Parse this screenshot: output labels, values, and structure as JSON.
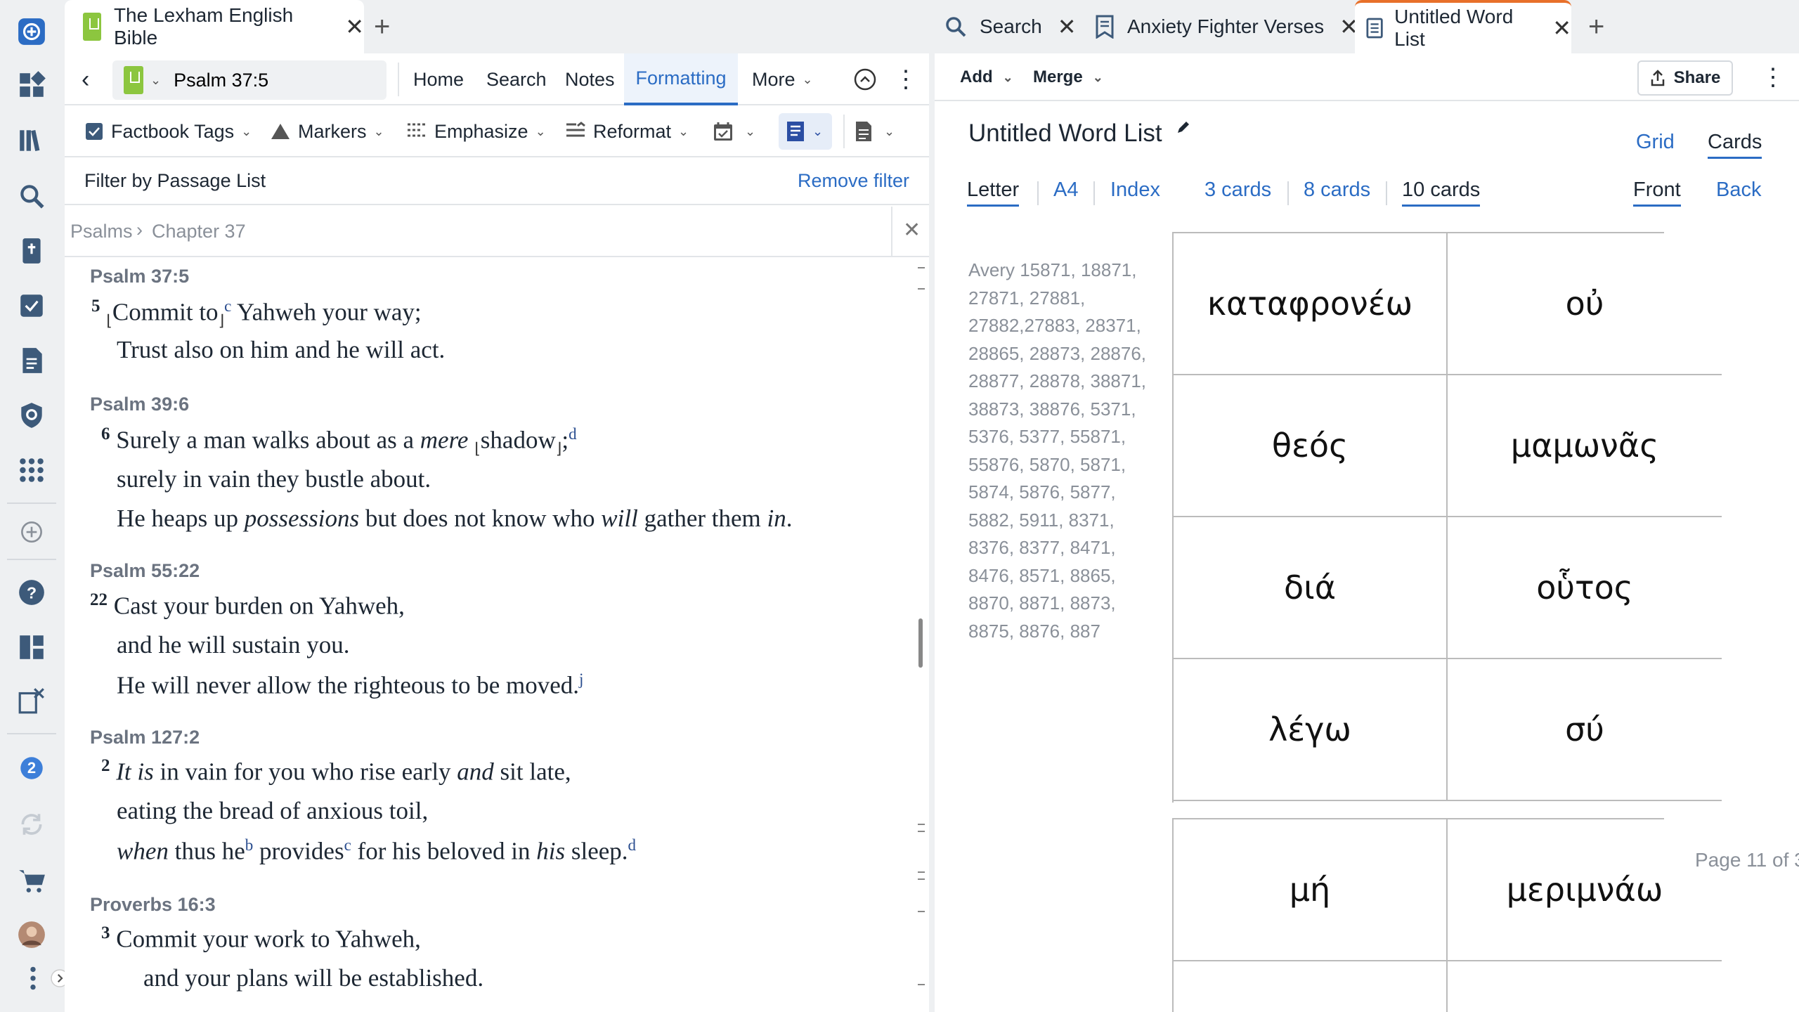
{
  "left": {
    "tab_title": "The Lexham English Bible",
    "reference": "Psalm 37:5",
    "nav": [
      "Home",
      "Search",
      "Notes",
      "Formatting",
      "More"
    ],
    "tools": {
      "factbook": "Factbook Tags",
      "markers": "Markers",
      "emphasize": "Emphasize",
      "reformat": "Reformat"
    },
    "filter_label": "Filter by Passage List",
    "remove_filter": "Remove filter",
    "breadcrumb": [
      "Psalms",
      "Chapter 37"
    ]
  },
  "passages": [
    {
      "heading": "Psalm 37:5",
      "verse": "5",
      "lines": [
        "Commit to",
        "Yahweh your way;",
        "Trust also on him and he will act."
      ],
      "fn": "c"
    },
    {
      "heading": "Psalm 39:6",
      "verse": "6",
      "lines": [
        "Surely a man walks about as a",
        "mere",
        "shadow",
        ";",
        "surely in vain they bustle about.",
        "He heaps up",
        "possessions",
        "but does not know who",
        "will",
        "gather them",
        "in",
        "."
      ],
      "fn": "d"
    },
    {
      "heading": "Psalm 55:22",
      "verse": "22",
      "lines": [
        "Cast your burden on Yahweh,",
        "and he will sustain you.",
        "He will never allow the righteous to be moved."
      ],
      "fn": "j"
    },
    {
      "heading": "Psalm 127:2",
      "verse": "2",
      "lines": [
        "It is",
        "in vain for you who rise early",
        "and",
        "sit late,",
        "eating the bread of anxious toil,",
        "when",
        "thus he",
        "provides",
        "for his beloved in",
        "his",
        "sleep."
      ],
      "fns": [
        "b",
        "c",
        "d"
      ]
    },
    {
      "heading": "Proverbs 16:3",
      "verse": "3",
      "lines": [
        "Commit your work to Yahweh,",
        "and your plans will be established."
      ]
    }
  ],
  "right": {
    "tabs": [
      "Search",
      "Anxiety Fighter Verses",
      "Untitled Word List"
    ],
    "add": "Add",
    "merge": "Merge",
    "share": "Share",
    "title": "Untitled Word List",
    "view_grid": "Grid",
    "view_cards": "Cards",
    "paper": [
      "Letter",
      "A4",
      "Index"
    ],
    "cards_per": [
      "3 cards",
      "8 cards",
      "10 cards"
    ],
    "side": [
      "Front",
      "Back"
    ],
    "avery": "Avery 15871, 18871, 27871, 27881, 27882,27883, 28371, 28865, 28873, 28876, 28877, 28878, 38871, 38873, 38876, 5371, 5376, 5377, 55871, 55876, 5870, 5871, 5874, 5876, 5877, 5882, 5911, 8371, 8376, 8377, 8471, 8476, 8571, 8865, 8870, 8871, 8873, 8875, 8876, 887",
    "cards": [
      "καταφρονέω",
      "οὐ",
      "θεός",
      "μαμωνᾶς",
      "διά",
      "οὗτος",
      "λέγω",
      "σύ",
      "μή",
      "μεριμνάω"
    ],
    "page_indicator": "Page 11 of 3"
  },
  "rail": {
    "badge": "2"
  }
}
